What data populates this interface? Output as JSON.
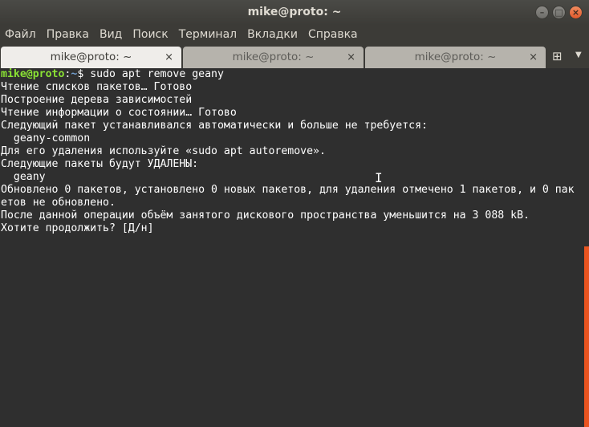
{
  "window": {
    "title": "mike@proto: ~",
    "buttons": {
      "minimize": "–",
      "maximize": "□",
      "close": "×"
    }
  },
  "menu": [
    "Файл",
    "Правка",
    "Вид",
    "Поиск",
    "Терминал",
    "Вкладки",
    "Справка"
  ],
  "tabs": [
    {
      "label": "mike@proto: ~",
      "close": "×",
      "active": true
    },
    {
      "label": "mike@proto: ~",
      "close": "×",
      "active": false
    },
    {
      "label": "mike@proto: ~",
      "close": "×",
      "active": false
    }
  ],
  "tab_controls": {
    "new_tab": "⊞",
    "menu": "▼"
  },
  "terminal": {
    "prompt_user": "mike@proto",
    "prompt_sep": ":",
    "prompt_path": "~",
    "prompt_symbol": "$ ",
    "command": "sudo apt remove geany",
    "output": [
      "Чтение списков пакетов… Готово",
      "Построение дерева зависимостей",
      "Чтение информации о состоянии… Готово",
      "Следующий пакет устанавливался автоматически и больше не требуется:",
      "  geany-common",
      "Для его удаления используйте «sudo apt autoremove».",
      "Следующие пакеты будут УДАЛЕНЫ:",
      "  geany",
      "Обновлено 0 пакетов, установлено 0 новых пакетов, для удаления отмечено 1 пакетов, и 0 пак",
      "етов не обновлено.",
      "После данной операции объём занятого дискового пространства уменьшится на 3 088 kB.",
      "Хотите продолжить? [Д/н]"
    ]
  },
  "colors": {
    "prompt_user": "#8ae234",
    "prompt_path": "#729fcf",
    "scroll_thumb": "#e95420",
    "background": "#2f2f2f"
  }
}
